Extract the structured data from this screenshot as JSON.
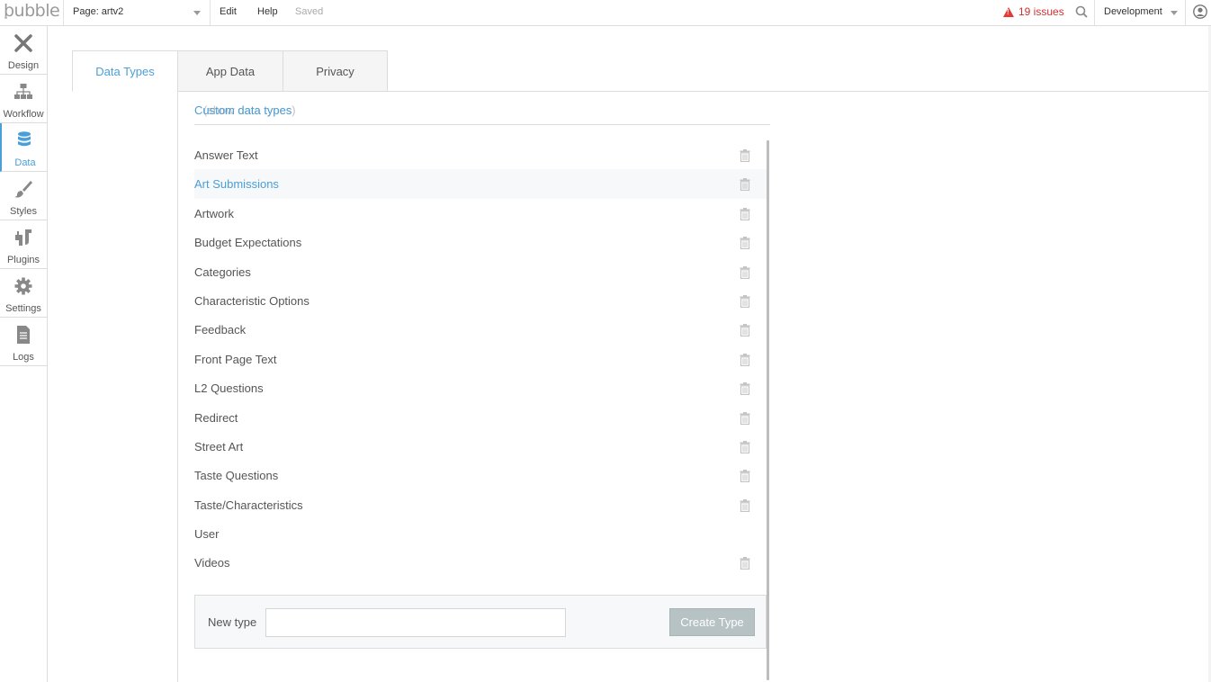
{
  "topbar": {
    "logo": "bubble",
    "page_label": "Page: artv2",
    "menu": {
      "edit": "Edit",
      "help": "Help",
      "status": "Saved"
    },
    "issues": "19 issues",
    "environment": "Development"
  },
  "sidebar": {
    "items": [
      {
        "label": "Design",
        "icon": "design-icon"
      },
      {
        "label": "Workflow",
        "icon": "workflow-icon"
      },
      {
        "label": "Data",
        "icon": "database-icon",
        "active": true
      },
      {
        "label": "Styles",
        "icon": "brush-icon"
      },
      {
        "label": "Plugins",
        "icon": "plug-icon"
      },
      {
        "label": "Settings",
        "icon": "gear-icon"
      },
      {
        "label": "Logs",
        "icon": "document-icon"
      }
    ]
  },
  "tabs": [
    {
      "label": "Data Types",
      "active": true
    },
    {
      "label": "App Data"
    },
    {
      "label": "Privacy"
    }
  ],
  "section": {
    "title": "Custom data types",
    "ghost_text": "(show data types)"
  },
  "data_types": [
    {
      "name": "Answer Text",
      "deletable": true
    },
    {
      "name": "Art Submissions",
      "deletable": true,
      "highlighted": true
    },
    {
      "name": "Artwork",
      "deletable": true
    },
    {
      "name": "Budget Expectations",
      "deletable": true
    },
    {
      "name": "Categories",
      "deletable": true
    },
    {
      "name": "Characteristic Options",
      "deletable": true
    },
    {
      "name": "Feedback",
      "deletable": true
    },
    {
      "name": "Front Page Text",
      "deletable": true
    },
    {
      "name": "L2 Questions",
      "deletable": true
    },
    {
      "name": "Redirect",
      "deletable": true
    },
    {
      "name": "Street Art",
      "deletable": true
    },
    {
      "name": "Taste Questions",
      "deletable": true
    },
    {
      "name": "Taste/Characteristics",
      "deletable": true
    },
    {
      "name": "User",
      "deletable": false
    },
    {
      "name": "Videos",
      "deletable": true
    }
  ],
  "new_type": {
    "label": "New type",
    "input_value": "",
    "placeholder": "",
    "button_label": "Create Type"
  },
  "colors": {
    "accent": "#4a9fd8",
    "issues": "#d32f2f",
    "button_disabled": "#b7c2c5"
  }
}
